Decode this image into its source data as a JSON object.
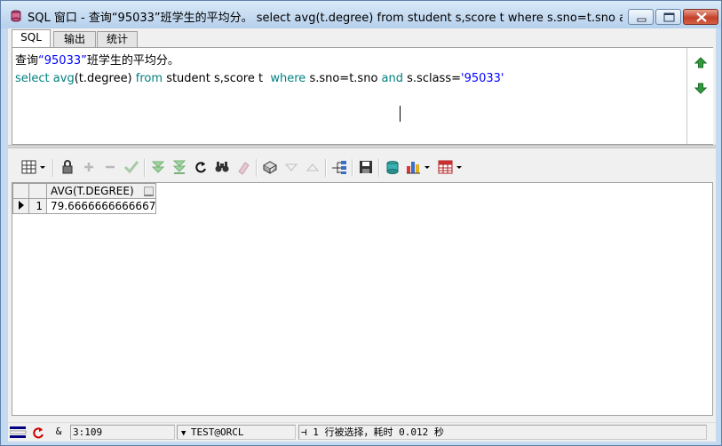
{
  "window": {
    "title": "SQL 窗口 - 查询“95033”班学生的平均分。 select avg(t.degree) from student s,score t where s.sno=t.sno and s.scl..."
  },
  "tabs": [
    {
      "label": "SQL",
      "active": true
    },
    {
      "label": "输出",
      "active": false
    },
    {
      "label": "统计",
      "active": false
    }
  ],
  "editor": {
    "line1_comment_a": "查询",
    "line1_string": "“95033”",
    "line1_comment_b": "班学生的平均分。",
    "line2": {
      "kw_select": "select",
      "fn_avg": "avg",
      "args": "(t.degree)",
      "kw_from": "from",
      "tables": "student s,score t",
      "kw_where": "where",
      "cond1": "s.sno=t.sno",
      "kw_and": "and",
      "cond2": "s.sclass=",
      "literal": "'95033'"
    }
  },
  "results": {
    "columns": [
      "AVG(T.DEGREE)"
    ],
    "rows": [
      {
        "num": "1",
        "values": [
          "79.6666666666667"
        ]
      }
    ]
  },
  "statusbar": {
    "mode": "&",
    "position": "3:109",
    "connection": "TEST@ORCL",
    "message": "1 行被选择，耗时 0.012 秒"
  },
  "icons": {
    "title": "sql-window-icon",
    "next": "arrow-down-icon",
    "prev": "arrow-up-icon"
  },
  "colors": {
    "keyword": "#008080",
    "string": "#0000ff",
    "close_button": "#c4412b",
    "title_bar": "#c3daf0"
  }
}
